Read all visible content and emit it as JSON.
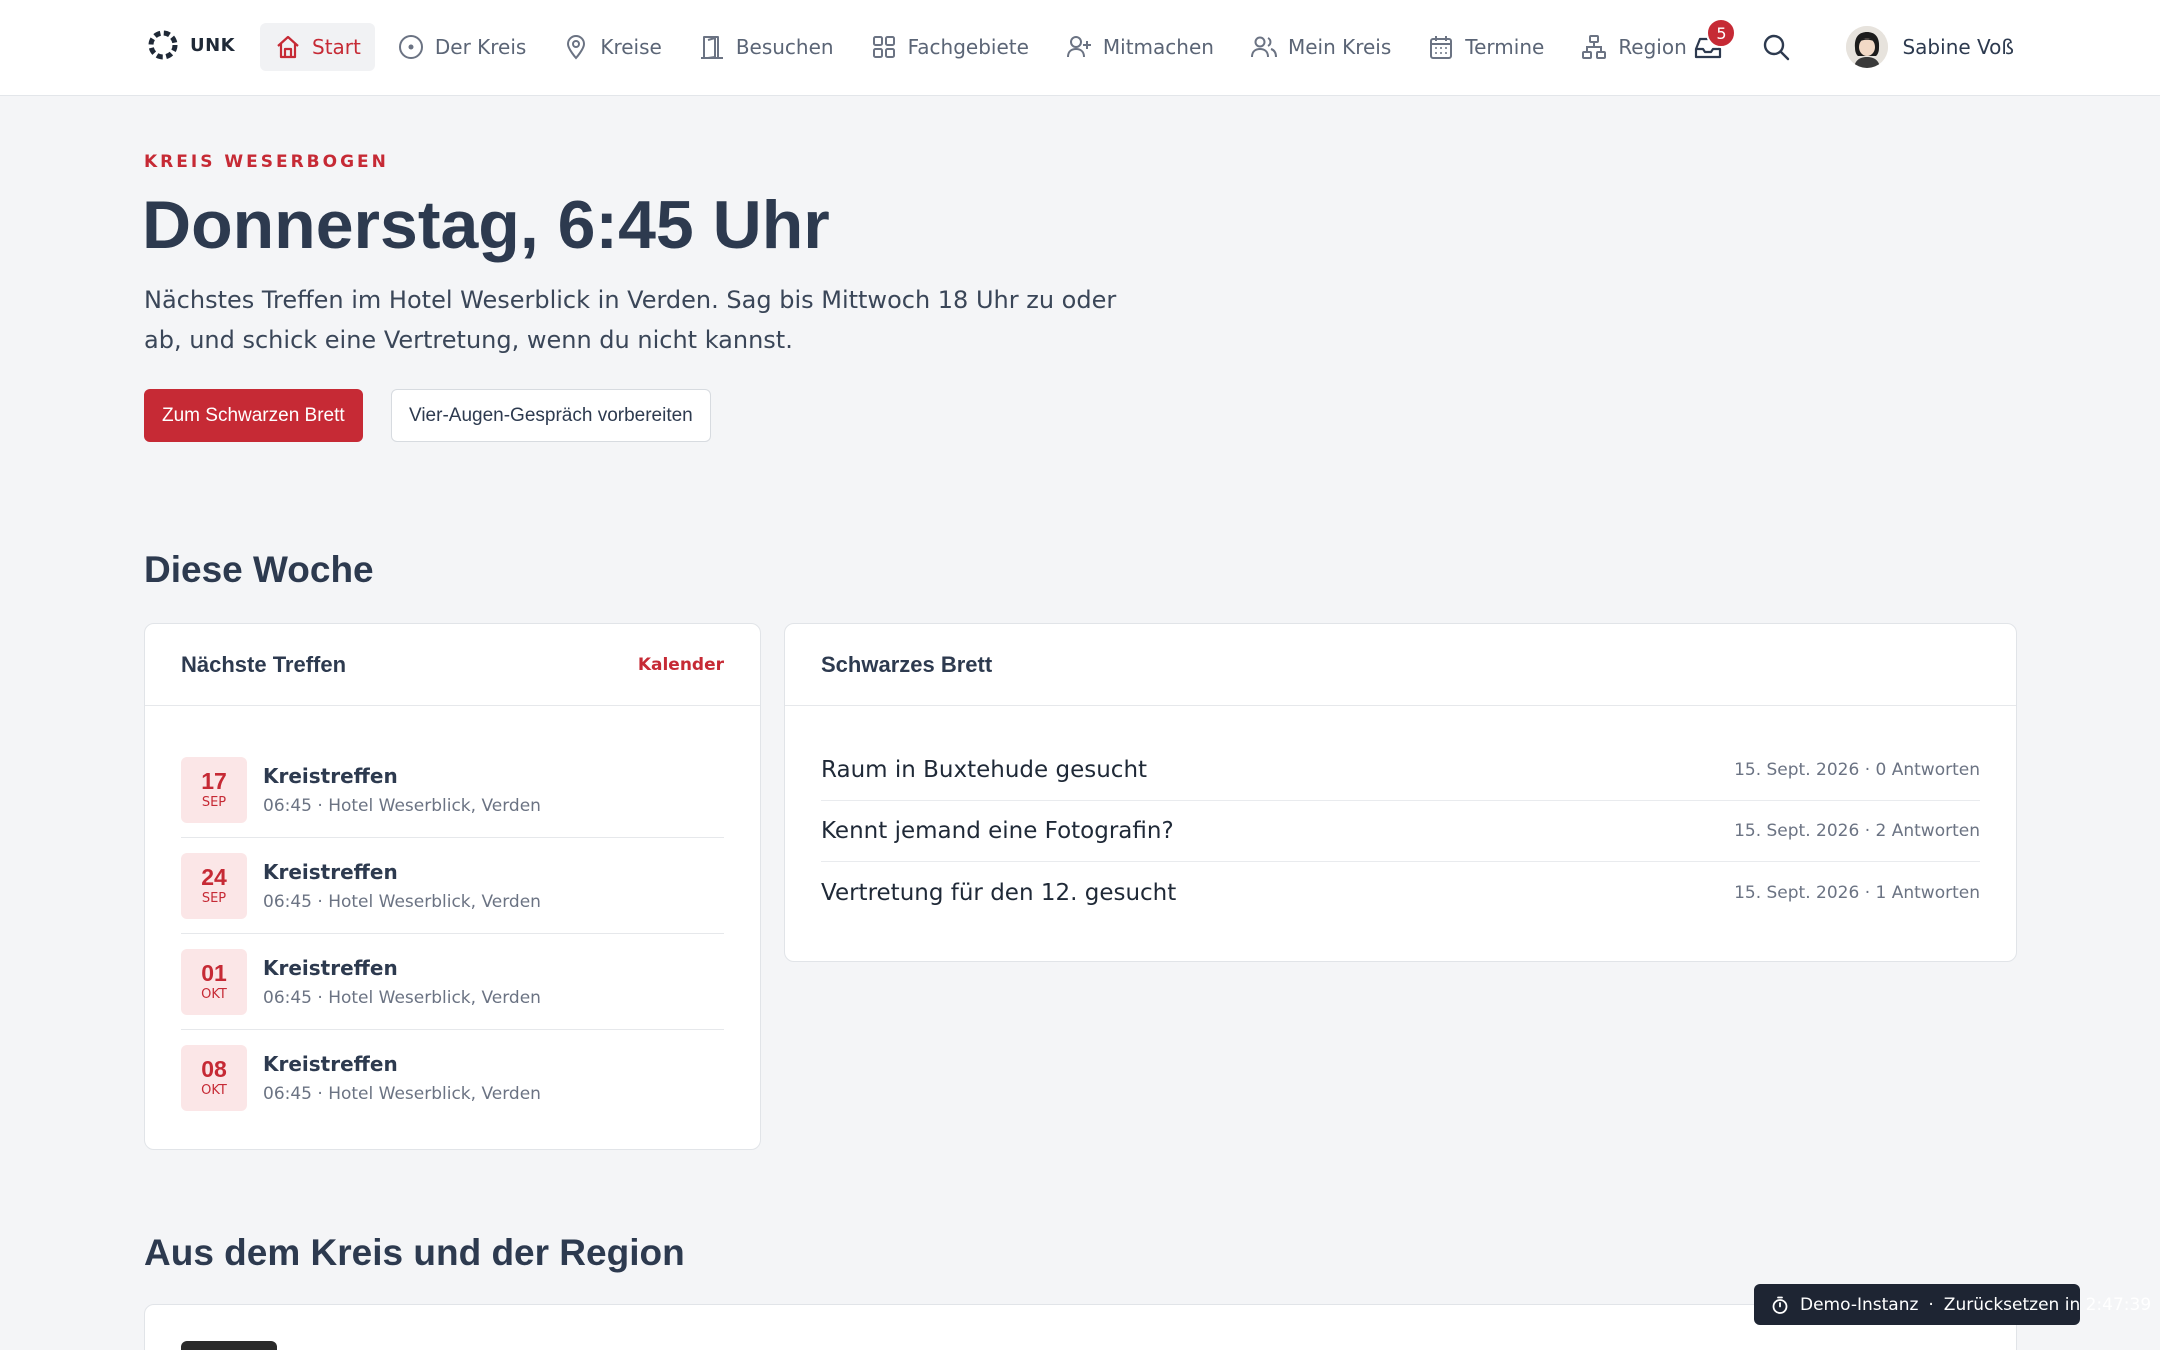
{
  "brand": {
    "name": "UNK"
  },
  "nav": {
    "items": [
      {
        "label": "Start",
        "icon": "home-icon"
      },
      {
        "label": "Der Kreis",
        "icon": "circle-dot-icon"
      },
      {
        "label": "Kreise",
        "icon": "map-pin-icon"
      },
      {
        "label": "Besuchen",
        "icon": "door-icon"
      },
      {
        "label": "Fachgebiete",
        "icon": "grid-icon"
      },
      {
        "label": "Mitmachen",
        "icon": "user-plus-icon"
      },
      {
        "label": "Mein Kreis",
        "icon": "users-icon"
      },
      {
        "label": "Termine",
        "icon": "calendar-icon"
      },
      {
        "label": "Region",
        "icon": "sitemap-icon"
      }
    ],
    "active": "Start",
    "notifications": "5",
    "user_name": "Sabine Voß"
  },
  "hero": {
    "eyebrow": "KREIS WESERBOGEN",
    "title": "Donnerstag, 6:45 Uhr",
    "text": "Nächstes Treffen im Hotel Weserblick in Verden. Sag bis Mittwoch 18 Uhr zu oder ab, und schick eine Vertretung, wenn du nicht kannst.",
    "primary_button": "Zum Schwarzen Brett",
    "secondary_button": "Vier-Augen-Gespräch vorbereiten"
  },
  "week": {
    "title": "Diese Woche",
    "meetings": {
      "title": "Nächste Treffen",
      "link": "Kalender",
      "items": [
        {
          "day": "17",
          "month": "SEP",
          "title": "Kreistreffen",
          "sub": "06:45 · Hotel Weserblick, Verden"
        },
        {
          "day": "24",
          "month": "SEP",
          "title": "Kreistreffen",
          "sub": "06:45 · Hotel Weserblick, Verden"
        },
        {
          "day": "01",
          "month": "OKT",
          "title": "Kreistreffen",
          "sub": "06:45 · Hotel Weserblick, Verden"
        },
        {
          "day": "08",
          "month": "OKT",
          "title": "Kreistreffen",
          "sub": "06:45 · Hotel Weserblick, Verden"
        }
      ]
    },
    "board": {
      "title": "Schwarzes Brett",
      "posts": [
        {
          "title": "Raum in Buxtehude gesucht",
          "meta": "15. Sept. 2026 · 0 Antworten"
        },
        {
          "title": "Kennt jemand eine Fotografin?",
          "meta": "15. Sept. 2026 · 2 Antworten"
        },
        {
          "title": "Vertretung für den 12. gesucht",
          "meta": "15. Sept. 2026 · 1 Antworten"
        }
      ]
    }
  },
  "region": {
    "title": "Aus dem Kreis und der Region"
  },
  "demo": {
    "label": "Demo-Instanz",
    "separator": "·",
    "reset": "Zurücksetzen in 2:47:39"
  },
  "colors": {
    "accent": "#c62a35",
    "text": "#2d3a4f",
    "background": "#f4f5f7"
  }
}
